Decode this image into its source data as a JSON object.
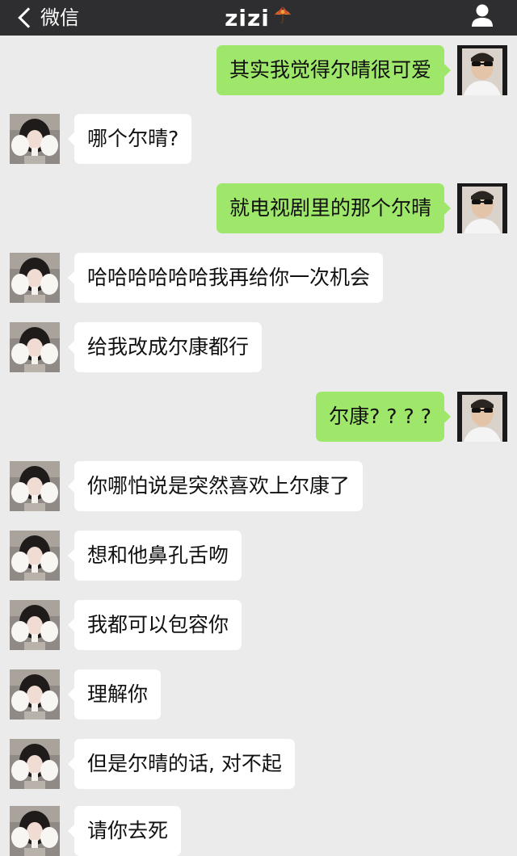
{
  "nav": {
    "back_label": "微信",
    "title": "zizi",
    "title_icon": "umbrella-icon",
    "right_icon": "person-icon"
  },
  "colors": {
    "nav_background": "#2e2e30",
    "chat_background": "#ebebeb",
    "outgoing_bubble": "#9ee76a",
    "incoming_bubble": "#ffffff"
  },
  "messages": [
    {
      "side": "out",
      "text": "其实我觉得尔晴很可爱"
    },
    {
      "side": "in",
      "text": "哪个尔晴?"
    },
    {
      "side": "out",
      "text": "就电视剧里的那个尔晴"
    },
    {
      "side": "in",
      "text": "哈哈哈哈哈哈我再给你一次机会"
    },
    {
      "side": "in",
      "text": "给我改成尔康都行"
    },
    {
      "side": "out",
      "text": "尔康? ? ? ?"
    },
    {
      "side": "in",
      "text": "你哪怕说是突然喜欢上尔康了"
    },
    {
      "side": "in",
      "text": "想和他鼻孔舌吻"
    },
    {
      "side": "in",
      "text": "我都可以包容你"
    },
    {
      "side": "in",
      "text": "理解你"
    },
    {
      "side": "in",
      "text": "但是尔晴的话, 对不起"
    },
    {
      "side": "in",
      "text": "请你去死"
    }
  ]
}
